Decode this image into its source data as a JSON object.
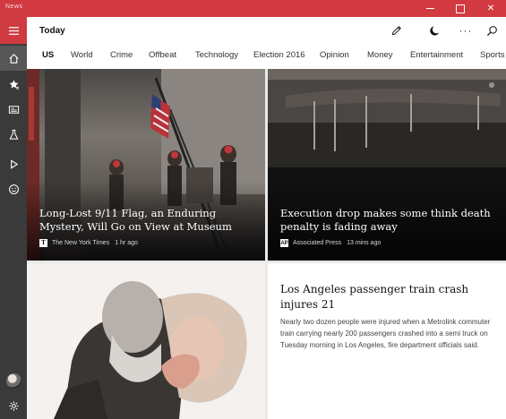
{
  "window": {
    "app_name": "News"
  },
  "header": {
    "title": "Today"
  },
  "tabs": [
    {
      "label": "US",
      "active": true
    },
    {
      "label": "World"
    },
    {
      "label": "Crime"
    },
    {
      "label": "Offbeat"
    },
    {
      "label": "Technology"
    },
    {
      "label": "Election 2016"
    },
    {
      "label": "Opinion"
    },
    {
      "label": "Money"
    },
    {
      "label": "Entertainment"
    },
    {
      "label": "Sports"
    }
  ],
  "articles": [
    {
      "headline": "Long-Lost 9/11 Flag, an Enduring Mystery, Will Go on View at Museum",
      "source": "The New York Times",
      "time": "1 hr ago",
      "source_logo": "T"
    },
    {
      "headline": "Execution drop makes some think death penalty is fading away",
      "source": "Associated Press",
      "time": "13 mins ago",
      "source_logo": "AP"
    },
    {
      "headline": "Los Angeles passenger train crash injures 21",
      "summary": "Nearly two dozen people were injured when a Metrolink commuter train carrying nearly 200 passengers crashed into a semi truck on Tuesday morning in Los Angeles, fire department officials said."
    }
  ],
  "colors": {
    "accent": "#d23a41",
    "sidebar": "#3a3a3a"
  },
  "icons": {
    "menu": "hamburger-icon",
    "home": "home-icon",
    "favorites": "star-icon",
    "local": "newspaper-icon",
    "interests": "flask-icon",
    "video": "play-icon",
    "feedback": "smiley-icon",
    "settings": "gear-icon",
    "edit": "pencil-icon",
    "night": "moon-icon",
    "more": "more-icon",
    "search": "search-icon"
  }
}
